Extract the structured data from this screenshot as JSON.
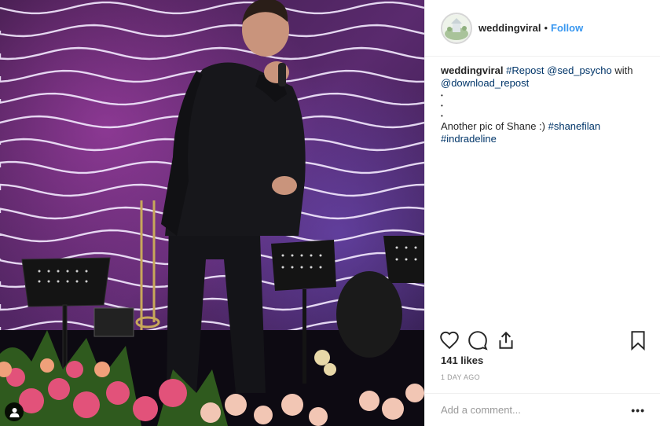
{
  "photo": {
    "subject": "singer performing on stage with microphone",
    "badge_icon": "user-tag-icon"
  },
  "header": {
    "username": "weddingviral",
    "separator": "•",
    "follow_label": "Follow",
    "avatar_icon": "profile-avatar"
  },
  "caption": {
    "user": "weddingviral",
    "tag_repost": "#Repost",
    "mention_1": "@sed_psycho",
    "with_text": " with",
    "mention_2": "@download_repost",
    "ellipsis": "•\n•\n•",
    "text": "Another pic of Shane :)",
    "tag_1": "#shanefilan",
    "tag_2": "#indradeline"
  },
  "actions": {
    "like_icon": "heart-icon",
    "comment_icon": "comment-icon",
    "share_icon": "share-icon",
    "save_icon": "bookmark-icon"
  },
  "likes": "141 likes",
  "timestamp": "1 DAY AGO",
  "comment": {
    "placeholder": "Add a comment...",
    "more_label": "•••"
  },
  "colors": {
    "link": "#3897f0",
    "hashtag": "#003569",
    "muted": "#999999",
    "border": "#efefef"
  }
}
